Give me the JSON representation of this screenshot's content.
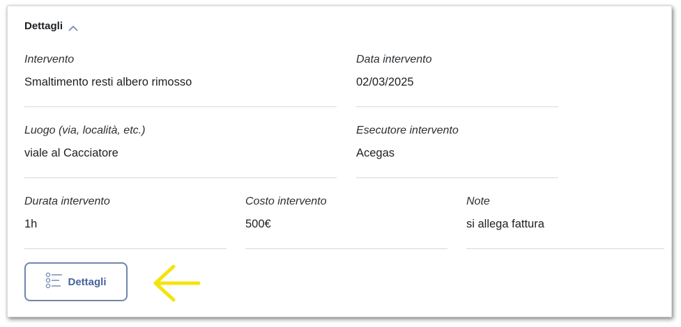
{
  "section": {
    "title": "Dettagli",
    "toggle_icon": "chevron-up-icon"
  },
  "fields": {
    "intervento": {
      "label": "Intervento",
      "value": "Smaltimento resti albero rimosso"
    },
    "data_intervento": {
      "label": "Data intervento",
      "value": "02/03/2025"
    },
    "luogo": {
      "label": "Luogo (via, località, etc.)",
      "value": "viale al Cacciatore"
    },
    "esecutore": {
      "label": "Esecutore intervento",
      "value": "Acegas"
    },
    "durata": {
      "label": "Durata intervento",
      "value": "1h"
    },
    "costo": {
      "label": "Costo intervento",
      "value": "500€"
    },
    "note": {
      "label": "Note",
      "value": "si allega fattura"
    }
  },
  "details_button": {
    "label": "Dettagli",
    "icon": "list-details-icon"
  },
  "annotation": {
    "icon": "arrow-left-icon",
    "color": "#f4e40c"
  },
  "colors": {
    "button_border": "#6f84ad",
    "button_text": "#46639a",
    "divider": "#d4d7db"
  }
}
